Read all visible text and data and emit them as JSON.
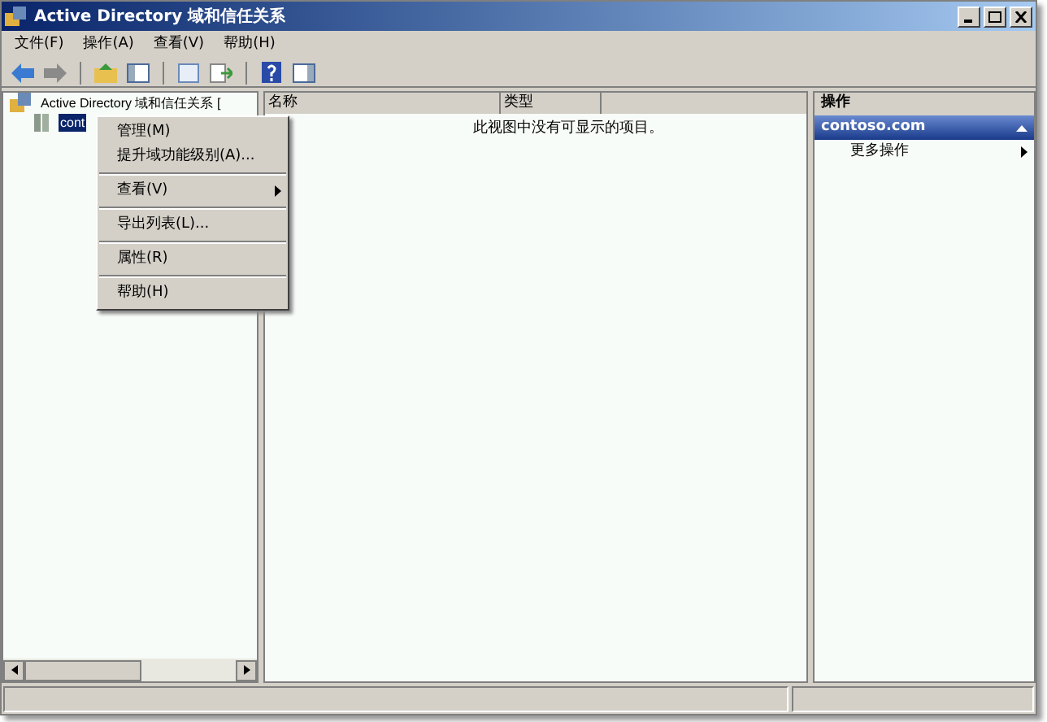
{
  "window": {
    "title": "Active Directory 域和信任关系"
  },
  "menu_bar": [
    "文件(F)",
    "操作(A)",
    "查看(V)",
    "帮助(H)"
  ],
  "tree": [
    {
      "label": "Active Directory 域和信任关系 [",
      "selected": false,
      "children": [
        {
          "label": "cont",
          "selected": true
        }
      ]
    }
  ],
  "context_menu": [
    {
      "kind": "item",
      "label": "管理(M)",
      "submenu": false
    },
    {
      "kind": "item",
      "label": "提升域功能级别(A)...",
      "submenu": false
    },
    {
      "kind": "separator"
    },
    {
      "kind": "item",
      "label": "查看(V)",
      "submenu": true
    },
    {
      "kind": "separator"
    },
    {
      "kind": "item",
      "label": "导出列表(L)...",
      "submenu": false
    },
    {
      "kind": "separator"
    },
    {
      "kind": "item",
      "label": "属性(R)",
      "submenu": false
    },
    {
      "kind": "separator"
    },
    {
      "kind": "item",
      "label": "帮助(H)",
      "submenu": false
    }
  ],
  "list": {
    "columns": [
      "名称",
      "类型"
    ],
    "empty_message": "此视图中没有可显示的项目。"
  },
  "actions": {
    "header": "操作",
    "section": {
      "title": "contoso.com",
      "expanded": true,
      "items": [
        {
          "label": "更多操作",
          "submenu": true
        }
      ]
    }
  }
}
